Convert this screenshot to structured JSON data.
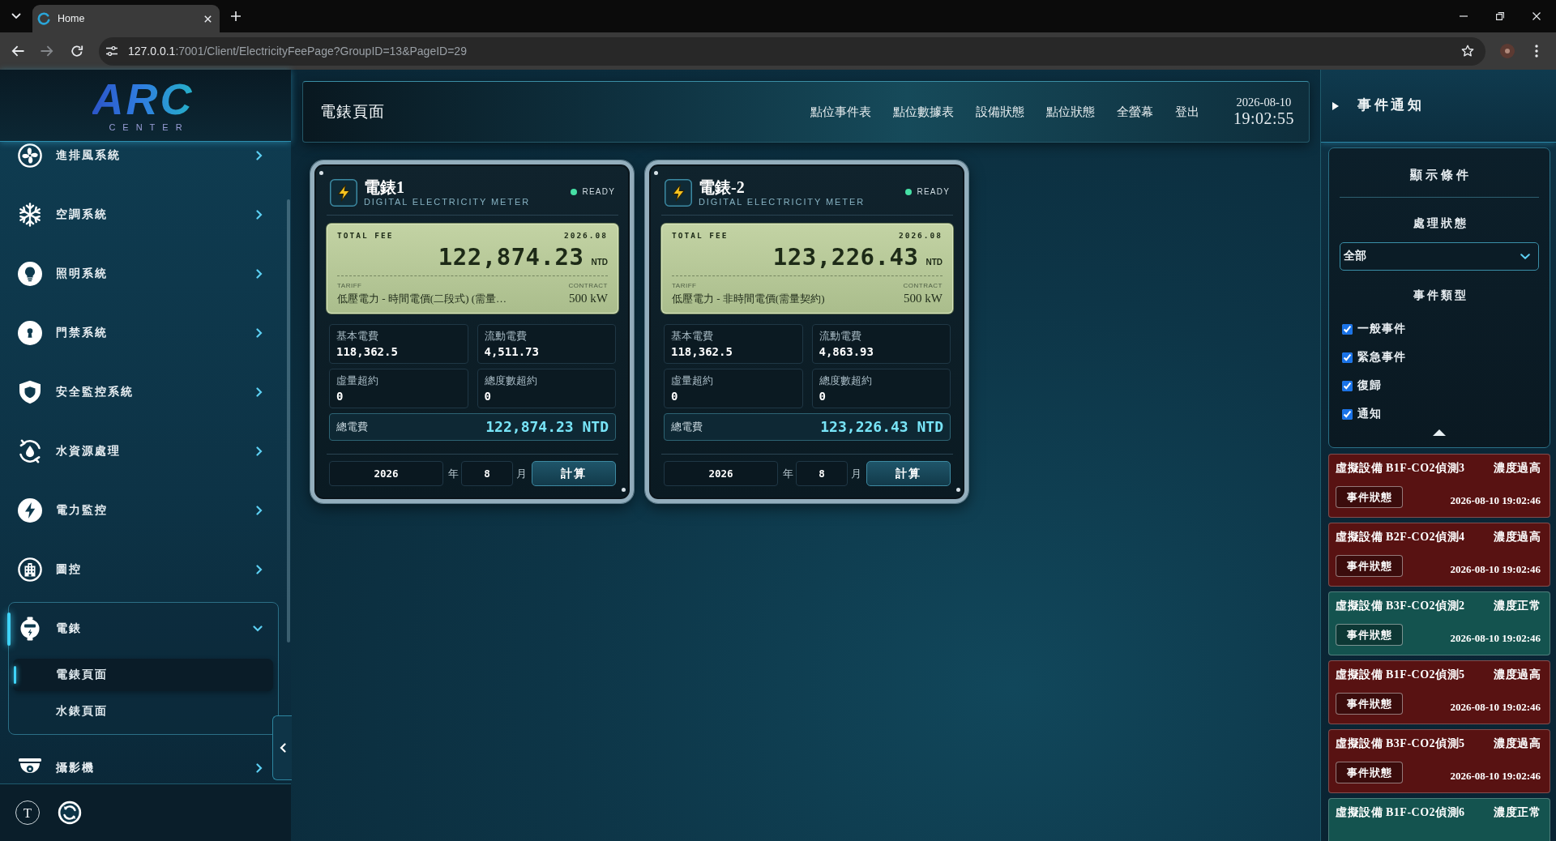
{
  "browser": {
    "tab_title": "Home",
    "url_host": "127.0.0.1",
    "url_path": ":7001/Client/ElectricityFeePage?GroupID=13&PageID=29"
  },
  "sidebar": {
    "logo_text": "ARC",
    "logo_subtitle": "CENTER",
    "items": [
      {
        "label": "進排風系統",
        "expanded": false
      },
      {
        "label": "空調系統",
        "expanded": false
      },
      {
        "label": "照明系統",
        "expanded": false
      },
      {
        "label": "門禁系統",
        "expanded": false
      },
      {
        "label": "安全監控系統",
        "expanded": false
      },
      {
        "label": "水資源處理",
        "expanded": false
      },
      {
        "label": "電力監控",
        "expanded": false
      },
      {
        "label": "圖控",
        "expanded": false
      },
      {
        "label": "電錶",
        "expanded": true,
        "children": [
          {
            "label": "電錶頁面",
            "selected": true
          },
          {
            "label": "水錶頁面",
            "selected": false
          }
        ]
      },
      {
        "label": "攝影機",
        "expanded": false
      }
    ],
    "footer_button": "T"
  },
  "header": {
    "title": "電錶頁面",
    "nav": [
      "點位事件表",
      "點位數據表",
      "設備狀態",
      "點位狀態",
      "全螢幕",
      "登出"
    ],
    "date": "2026-08-10",
    "time": "19:02:55"
  },
  "meters": [
    {
      "title": "電錶1",
      "subtitle": "DIGITAL ELECTRICITY METER",
      "status": "READY",
      "fee_label": "TOTAL FEE",
      "period": "2026.08",
      "total": "122,874.23",
      "unit": "NTD",
      "tariff_label": "TARIFF",
      "tariff": "低壓電力 - 時間電價(二段式) (需量…",
      "contract_label": "CONTRACT",
      "contract": "500 kW",
      "stats": [
        {
          "label": "基本電費",
          "value": "118,362.5"
        },
        {
          "label": "流動電費",
          "value": "4,511.73"
        },
        {
          "label": "虛量超約",
          "value": "0"
        },
        {
          "label": "總度數超約",
          "value": "0"
        }
      ],
      "sum_label": "總電費",
      "sum_value": "122,874.23 NTD",
      "year": "2026",
      "year_unit": "年",
      "month": "8",
      "month_unit": "月",
      "button": "計算"
    },
    {
      "title": "電錶-2",
      "subtitle": "DIGITAL ELECTRICITY METER",
      "status": "READY",
      "fee_label": "TOTAL FEE",
      "period": "2026.08",
      "total": "123,226.43",
      "unit": "NTD",
      "tariff_label": "TARIFF",
      "tariff": "低壓電力 - 非時間電價(需量契約)",
      "contract_label": "CONTRACT",
      "contract": "500 kW",
      "stats": [
        {
          "label": "基本電費",
          "value": "118,362.5"
        },
        {
          "label": "流動電費",
          "value": "4,863.93"
        },
        {
          "label": "虛量超約",
          "value": "0"
        },
        {
          "label": "總度數超約",
          "value": "0"
        }
      ],
      "sum_label": "總電費",
      "sum_value": "123,226.43 NTD",
      "year": "2026",
      "year_unit": "年",
      "month": "8",
      "month_unit": "月",
      "button": "計算"
    }
  ],
  "events_panel": {
    "title": "事件通知",
    "filter": {
      "title": "顯示條件",
      "status_label": "處理狀態",
      "status_value": "全部",
      "type_label": "事件類型",
      "types": [
        {
          "label": "一般事件",
          "checked": true
        },
        {
          "label": "緊急事件",
          "checked": true
        },
        {
          "label": "復歸",
          "checked": true
        },
        {
          "label": "通知",
          "checked": true
        }
      ]
    },
    "events": [
      {
        "device": "虛擬設備 B1F-CO2偵測3",
        "status": "濃度過高",
        "button": "事件狀態",
        "time": "2026-08-10 19:02:46",
        "color": "#581212"
      },
      {
        "device": "虛擬設備 B2F-CO2偵測4",
        "status": "濃度過高",
        "button": "事件狀態",
        "time": "2026-08-10 19:02:46",
        "color": "#581212"
      },
      {
        "device": "虛擬設備 B3F-CO2偵測2",
        "status": "濃度正常",
        "button": "事件狀態",
        "time": "2026-08-10 19:02:46",
        "color": "#14534f"
      },
      {
        "device": "虛擬設備 B1F-CO2偵測5",
        "status": "濃度過高",
        "button": "事件狀態",
        "time": "2026-08-10 19:02:46",
        "color": "#581212"
      },
      {
        "device": "虛擬設備 B3F-CO2偵測5",
        "status": "濃度過高",
        "button": "事件狀態",
        "time": "2026-08-10 19:02:46",
        "color": "#581212"
      },
      {
        "device": "虛擬設備 B1F-CO2偵測6",
        "status": "濃度正常",
        "color": "#14534f"
      }
    ]
  }
}
